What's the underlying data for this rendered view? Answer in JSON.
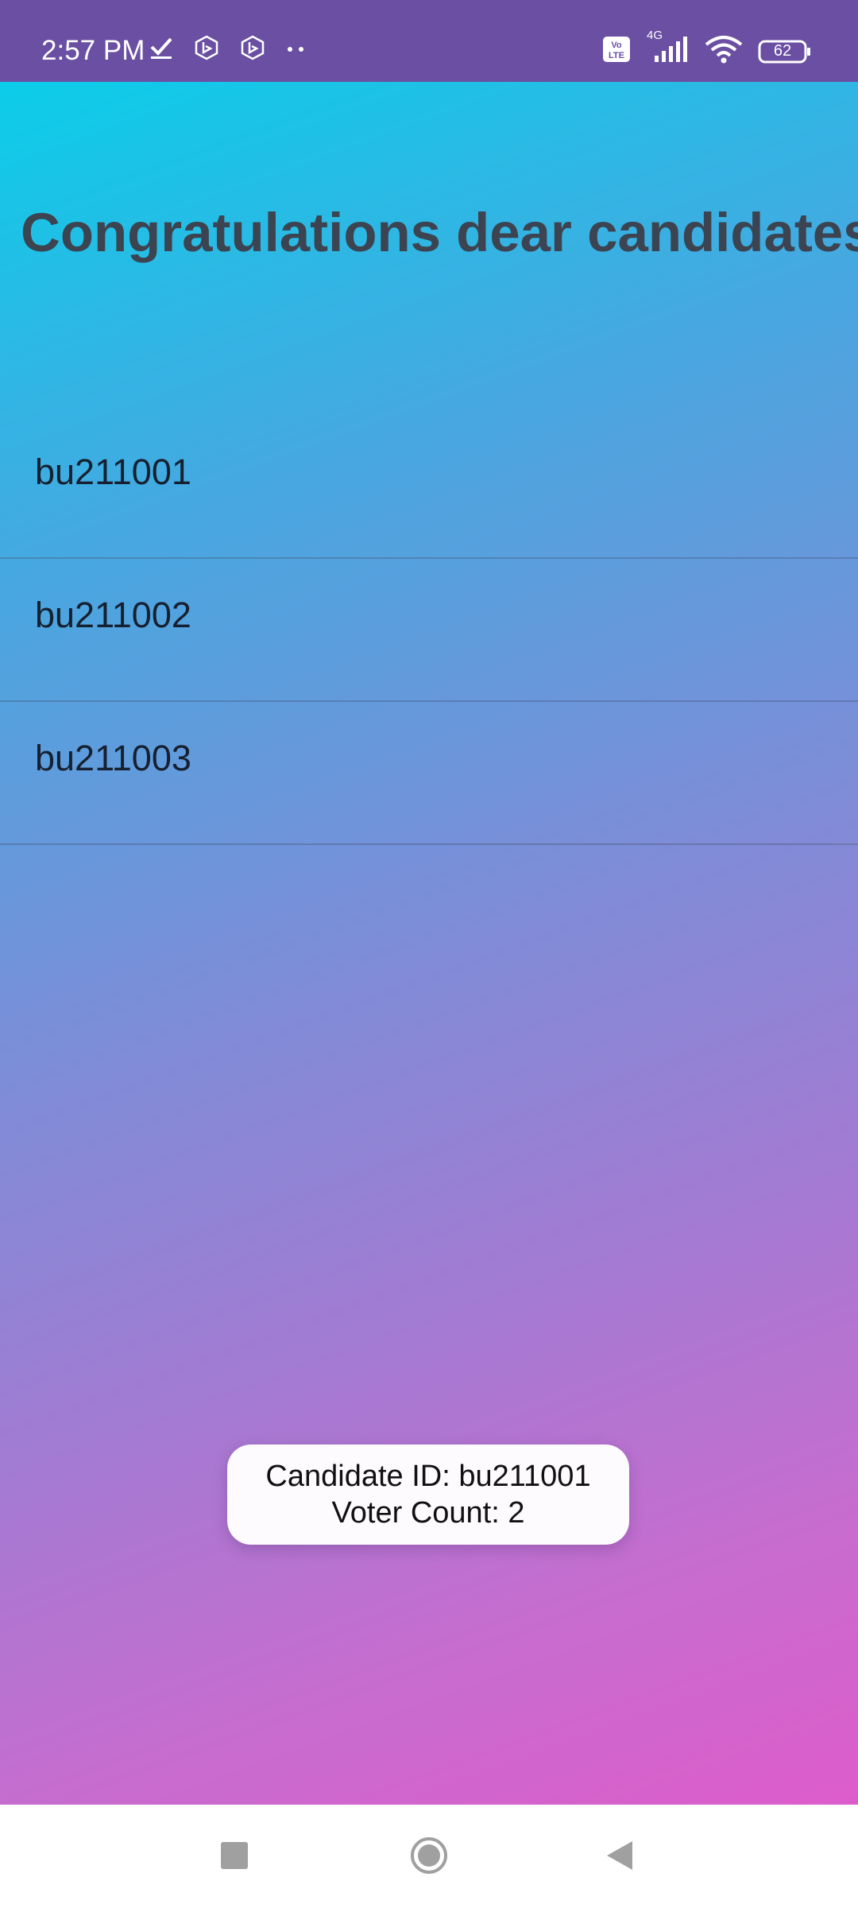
{
  "status_bar": {
    "time": "2:57 PM",
    "network": "4G",
    "volte": "Vo LTE",
    "battery": "62"
  },
  "main": {
    "title": "Congratulations dear candidates",
    "candidates": [
      "bu211001",
      "bu211002",
      "bu211003"
    ]
  },
  "toast": {
    "line1": "Candidate ID: bu211001",
    "line2": "Voter Count: 2"
  }
}
